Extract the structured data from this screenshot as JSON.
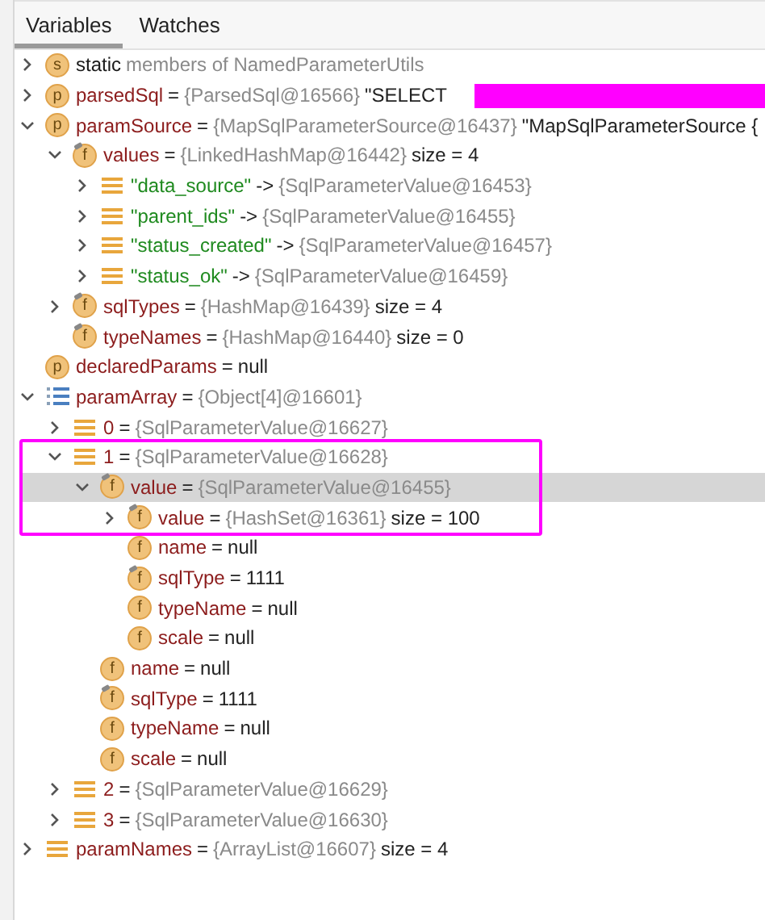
{
  "tabs": [
    {
      "label": "Variables",
      "selected": true
    },
    {
      "label": "Watches",
      "selected": false
    }
  ],
  "tree": [
    {
      "kind": "keyword",
      "icon": {
        "kind": "letter",
        "text": "s",
        "badge": false
      },
      "name": "static",
      "type": "members of NamedParameterUtils",
      "expanded": false,
      "selected": false
    },
    {
      "kind": "field",
      "icon": {
        "kind": "letter",
        "text": "p",
        "badge": false
      },
      "name": "parsedSql",
      "separator": "=",
      "type": "{ParsedSql@16566}",
      "value": "\"SELECT",
      "redacted": true,
      "expanded": false,
      "selected": false
    },
    {
      "kind": "field",
      "icon": {
        "kind": "letter",
        "text": "p",
        "badge": false
      },
      "name": "paramSource",
      "separator": "=",
      "type": "{MapSqlParameterSource@16437}",
      "value": "\"MapSqlParameterSource {",
      "expanded": true,
      "selected": false,
      "children": [
        {
          "kind": "field",
          "icon": {
            "kind": "letter",
            "text": "f",
            "badge": true
          },
          "name": "values",
          "separator": "=",
          "type": "{LinkedHashMap@16442}",
          "value": "size = 4",
          "expanded": true,
          "selected": false,
          "children": [
            {
              "kind": "string",
              "icon": {
                "kind": "entry"
              },
              "name": "\"data_source\"",
              "separator": "->",
              "type": "{SqlParameterValue@16453}",
              "expanded": false,
              "selected": false
            },
            {
              "kind": "string",
              "icon": {
                "kind": "entry"
              },
              "name": "\"parent_ids\"",
              "separator": "->",
              "type": "{SqlParameterValue@16455}",
              "expanded": false,
              "selected": false
            },
            {
              "kind": "string",
              "icon": {
                "kind": "entry"
              },
              "name": "\"status_created\"",
              "separator": "->",
              "type": "{SqlParameterValue@16457}",
              "expanded": false,
              "selected": false
            },
            {
              "kind": "string",
              "icon": {
                "kind": "entry"
              },
              "name": "\"status_ok\"",
              "separator": "->",
              "type": "{SqlParameterValue@16459}",
              "expanded": false,
              "selected": false
            }
          ]
        },
        {
          "kind": "field",
          "icon": {
            "kind": "letter",
            "text": "f",
            "badge": true
          },
          "name": "sqlTypes",
          "separator": "=",
          "type": "{HashMap@16439}",
          "value": "size = 4",
          "expanded": false,
          "selected": false
        },
        {
          "kind": "field",
          "icon": {
            "kind": "letter",
            "text": "f",
            "badge": true
          },
          "name": "typeNames",
          "separator": "=",
          "type": "{HashMap@16440}",
          "value": "size = 0",
          "selected": false
        }
      ]
    },
    {
      "kind": "field",
      "icon": {
        "kind": "letter",
        "text": "p",
        "badge": false
      },
      "name": "declaredParams",
      "separator": "=",
      "value": "null",
      "selected": false
    },
    {
      "kind": "field",
      "icon": {
        "kind": "array"
      },
      "name": "paramArray",
      "separator": "=",
      "type": "{Object[4]@16601}",
      "expanded": true,
      "selected": false,
      "children": [
        {
          "kind": "field",
          "icon": {
            "kind": "entry"
          },
          "name": "0",
          "separator": "=",
          "type": "{SqlParameterValue@16627}",
          "expanded": false,
          "selected": false
        },
        {
          "kind": "field",
          "icon": {
            "kind": "entry"
          },
          "name": "1",
          "separator": "=",
          "type": "{SqlParameterValue@16628}",
          "expanded": true,
          "selected": false,
          "framed": true,
          "children": [
            {
              "kind": "field",
              "icon": {
                "kind": "letter",
                "text": "f",
                "badge": true
              },
              "name": "value",
              "separator": "=",
              "type": "{SqlParameterValue@16455}",
              "expanded": true,
              "selected": true,
              "framed": true,
              "children": [
                {
                  "kind": "field",
                  "icon": {
                    "kind": "letter",
                    "text": "f",
                    "badge": true
                  },
                  "name": "value",
                  "separator": "=",
                  "type": "{HashSet@16361}",
                  "value": "size = 100",
                  "expanded": false,
                  "selected": false,
                  "framed": true
                },
                {
                  "kind": "field",
                  "icon": {
                    "kind": "letter",
                    "text": "f",
                    "badge": false
                  },
                  "name": "name",
                  "separator": "=",
                  "value": "null",
                  "selected": false
                },
                {
                  "kind": "field",
                  "icon": {
                    "kind": "letter",
                    "text": "f",
                    "badge": true
                  },
                  "name": "sqlType",
                  "separator": "=",
                  "value": "1111",
                  "selected": false
                },
                {
                  "kind": "field",
                  "icon": {
                    "kind": "letter",
                    "text": "f",
                    "badge": false
                  },
                  "name": "typeName",
                  "separator": "=",
                  "value": "null",
                  "selected": false
                },
                {
                  "kind": "field",
                  "icon": {
                    "kind": "letter",
                    "text": "f",
                    "badge": false
                  },
                  "name": "scale",
                  "separator": "=",
                  "value": "null",
                  "selected": false
                }
              ]
            },
            {
              "kind": "field",
              "icon": {
                "kind": "letter",
                "text": "f",
                "badge": false
              },
              "name": "name",
              "separator": "=",
              "value": "null",
              "selected": false
            },
            {
              "kind": "field",
              "icon": {
                "kind": "letter",
                "text": "f",
                "badge": true
              },
              "name": "sqlType",
              "separator": "=",
              "value": "1111",
              "selected": false
            },
            {
              "kind": "field",
              "icon": {
                "kind": "letter",
                "text": "f",
                "badge": false
              },
              "name": "typeName",
              "separator": "=",
              "value": "null",
              "selected": false
            },
            {
              "kind": "field",
              "icon": {
                "kind": "letter",
                "text": "f",
                "badge": false
              },
              "name": "scale",
              "separator": "=",
              "value": "null",
              "selected": false
            }
          ]
        },
        {
          "kind": "field",
          "icon": {
            "kind": "entry"
          },
          "name": "2",
          "separator": "=",
          "type": "{SqlParameterValue@16629}",
          "expanded": false,
          "selected": false
        },
        {
          "kind": "field",
          "icon": {
            "kind": "entry"
          },
          "name": "3",
          "separator": "=",
          "type": "{SqlParameterValue@16630}",
          "expanded": false,
          "selected": false
        }
      ]
    },
    {
      "kind": "field",
      "icon": {
        "kind": "entry"
      },
      "name": "paramNames",
      "separator": "=",
      "type": "{ArrayList@16607}",
      "value": "size = 4",
      "expanded": false,
      "selected": false
    }
  ]
}
